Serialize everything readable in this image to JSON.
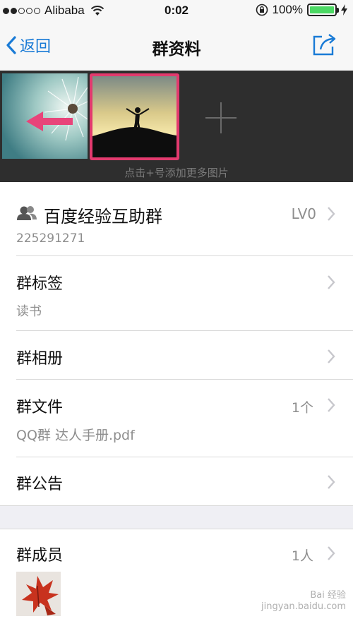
{
  "status_bar": {
    "carrier": "Alibaba",
    "time": "0:02",
    "battery": "100%"
  },
  "nav": {
    "back_label": "返回",
    "title": "群资料"
  },
  "photos": {
    "add_hint": "点击+号添加更多图片"
  },
  "group": {
    "name": "百度经验互助群",
    "id": "225291271",
    "level": "LV0"
  },
  "tags": {
    "label": "群标签",
    "value": "读书"
  },
  "album": {
    "label": "群相册"
  },
  "files": {
    "label": "群文件",
    "count": "1个",
    "file_name": "QQ群 达人手册.pdf"
  },
  "notice": {
    "label": "群公告"
  },
  "members": {
    "label": "群成员",
    "count": "1人"
  },
  "colors": {
    "accent": "#1a7bd6",
    "highlight_border": "#e23a6e",
    "battery": "#4cd964"
  }
}
